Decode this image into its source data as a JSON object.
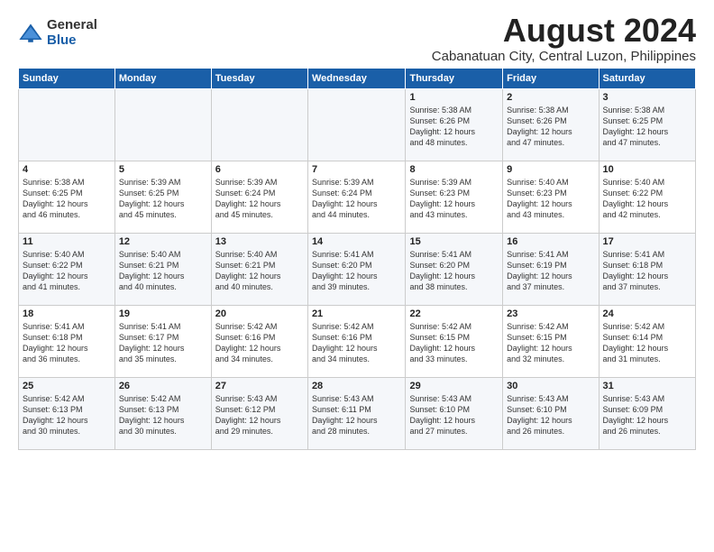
{
  "logo": {
    "general": "General",
    "blue": "Blue"
  },
  "title": "August 2024",
  "location": "Cabanatuan City, Central Luzon, Philippines",
  "days_of_week": [
    "Sunday",
    "Monday",
    "Tuesday",
    "Wednesday",
    "Thursday",
    "Friday",
    "Saturday"
  ],
  "weeks": [
    [
      {
        "day": "",
        "info": ""
      },
      {
        "day": "",
        "info": ""
      },
      {
        "day": "",
        "info": ""
      },
      {
        "day": "",
        "info": ""
      },
      {
        "day": "1",
        "info": "Sunrise: 5:38 AM\nSunset: 6:26 PM\nDaylight: 12 hours\nand 48 minutes."
      },
      {
        "day": "2",
        "info": "Sunrise: 5:38 AM\nSunset: 6:26 PM\nDaylight: 12 hours\nand 47 minutes."
      },
      {
        "day": "3",
        "info": "Sunrise: 5:38 AM\nSunset: 6:25 PM\nDaylight: 12 hours\nand 47 minutes."
      }
    ],
    [
      {
        "day": "4",
        "info": "Sunrise: 5:38 AM\nSunset: 6:25 PM\nDaylight: 12 hours\nand 46 minutes."
      },
      {
        "day": "5",
        "info": "Sunrise: 5:39 AM\nSunset: 6:25 PM\nDaylight: 12 hours\nand 45 minutes."
      },
      {
        "day": "6",
        "info": "Sunrise: 5:39 AM\nSunset: 6:24 PM\nDaylight: 12 hours\nand 45 minutes."
      },
      {
        "day": "7",
        "info": "Sunrise: 5:39 AM\nSunset: 6:24 PM\nDaylight: 12 hours\nand 44 minutes."
      },
      {
        "day": "8",
        "info": "Sunrise: 5:39 AM\nSunset: 6:23 PM\nDaylight: 12 hours\nand 43 minutes."
      },
      {
        "day": "9",
        "info": "Sunrise: 5:40 AM\nSunset: 6:23 PM\nDaylight: 12 hours\nand 43 minutes."
      },
      {
        "day": "10",
        "info": "Sunrise: 5:40 AM\nSunset: 6:22 PM\nDaylight: 12 hours\nand 42 minutes."
      }
    ],
    [
      {
        "day": "11",
        "info": "Sunrise: 5:40 AM\nSunset: 6:22 PM\nDaylight: 12 hours\nand 41 minutes."
      },
      {
        "day": "12",
        "info": "Sunrise: 5:40 AM\nSunset: 6:21 PM\nDaylight: 12 hours\nand 40 minutes."
      },
      {
        "day": "13",
        "info": "Sunrise: 5:40 AM\nSunset: 6:21 PM\nDaylight: 12 hours\nand 40 minutes."
      },
      {
        "day": "14",
        "info": "Sunrise: 5:41 AM\nSunset: 6:20 PM\nDaylight: 12 hours\nand 39 minutes."
      },
      {
        "day": "15",
        "info": "Sunrise: 5:41 AM\nSunset: 6:20 PM\nDaylight: 12 hours\nand 38 minutes."
      },
      {
        "day": "16",
        "info": "Sunrise: 5:41 AM\nSunset: 6:19 PM\nDaylight: 12 hours\nand 37 minutes."
      },
      {
        "day": "17",
        "info": "Sunrise: 5:41 AM\nSunset: 6:18 PM\nDaylight: 12 hours\nand 37 minutes."
      }
    ],
    [
      {
        "day": "18",
        "info": "Sunrise: 5:41 AM\nSunset: 6:18 PM\nDaylight: 12 hours\nand 36 minutes."
      },
      {
        "day": "19",
        "info": "Sunrise: 5:41 AM\nSunset: 6:17 PM\nDaylight: 12 hours\nand 35 minutes."
      },
      {
        "day": "20",
        "info": "Sunrise: 5:42 AM\nSunset: 6:16 PM\nDaylight: 12 hours\nand 34 minutes."
      },
      {
        "day": "21",
        "info": "Sunrise: 5:42 AM\nSunset: 6:16 PM\nDaylight: 12 hours\nand 34 minutes."
      },
      {
        "day": "22",
        "info": "Sunrise: 5:42 AM\nSunset: 6:15 PM\nDaylight: 12 hours\nand 33 minutes."
      },
      {
        "day": "23",
        "info": "Sunrise: 5:42 AM\nSunset: 6:15 PM\nDaylight: 12 hours\nand 32 minutes."
      },
      {
        "day": "24",
        "info": "Sunrise: 5:42 AM\nSunset: 6:14 PM\nDaylight: 12 hours\nand 31 minutes."
      }
    ],
    [
      {
        "day": "25",
        "info": "Sunrise: 5:42 AM\nSunset: 6:13 PM\nDaylight: 12 hours\nand 30 minutes."
      },
      {
        "day": "26",
        "info": "Sunrise: 5:42 AM\nSunset: 6:13 PM\nDaylight: 12 hours\nand 30 minutes."
      },
      {
        "day": "27",
        "info": "Sunrise: 5:43 AM\nSunset: 6:12 PM\nDaylight: 12 hours\nand 29 minutes."
      },
      {
        "day": "28",
        "info": "Sunrise: 5:43 AM\nSunset: 6:11 PM\nDaylight: 12 hours\nand 28 minutes."
      },
      {
        "day": "29",
        "info": "Sunrise: 5:43 AM\nSunset: 6:10 PM\nDaylight: 12 hours\nand 27 minutes."
      },
      {
        "day": "30",
        "info": "Sunrise: 5:43 AM\nSunset: 6:10 PM\nDaylight: 12 hours\nand 26 minutes."
      },
      {
        "day": "31",
        "info": "Sunrise: 5:43 AM\nSunset: 6:09 PM\nDaylight: 12 hours\nand 26 minutes."
      }
    ]
  ]
}
